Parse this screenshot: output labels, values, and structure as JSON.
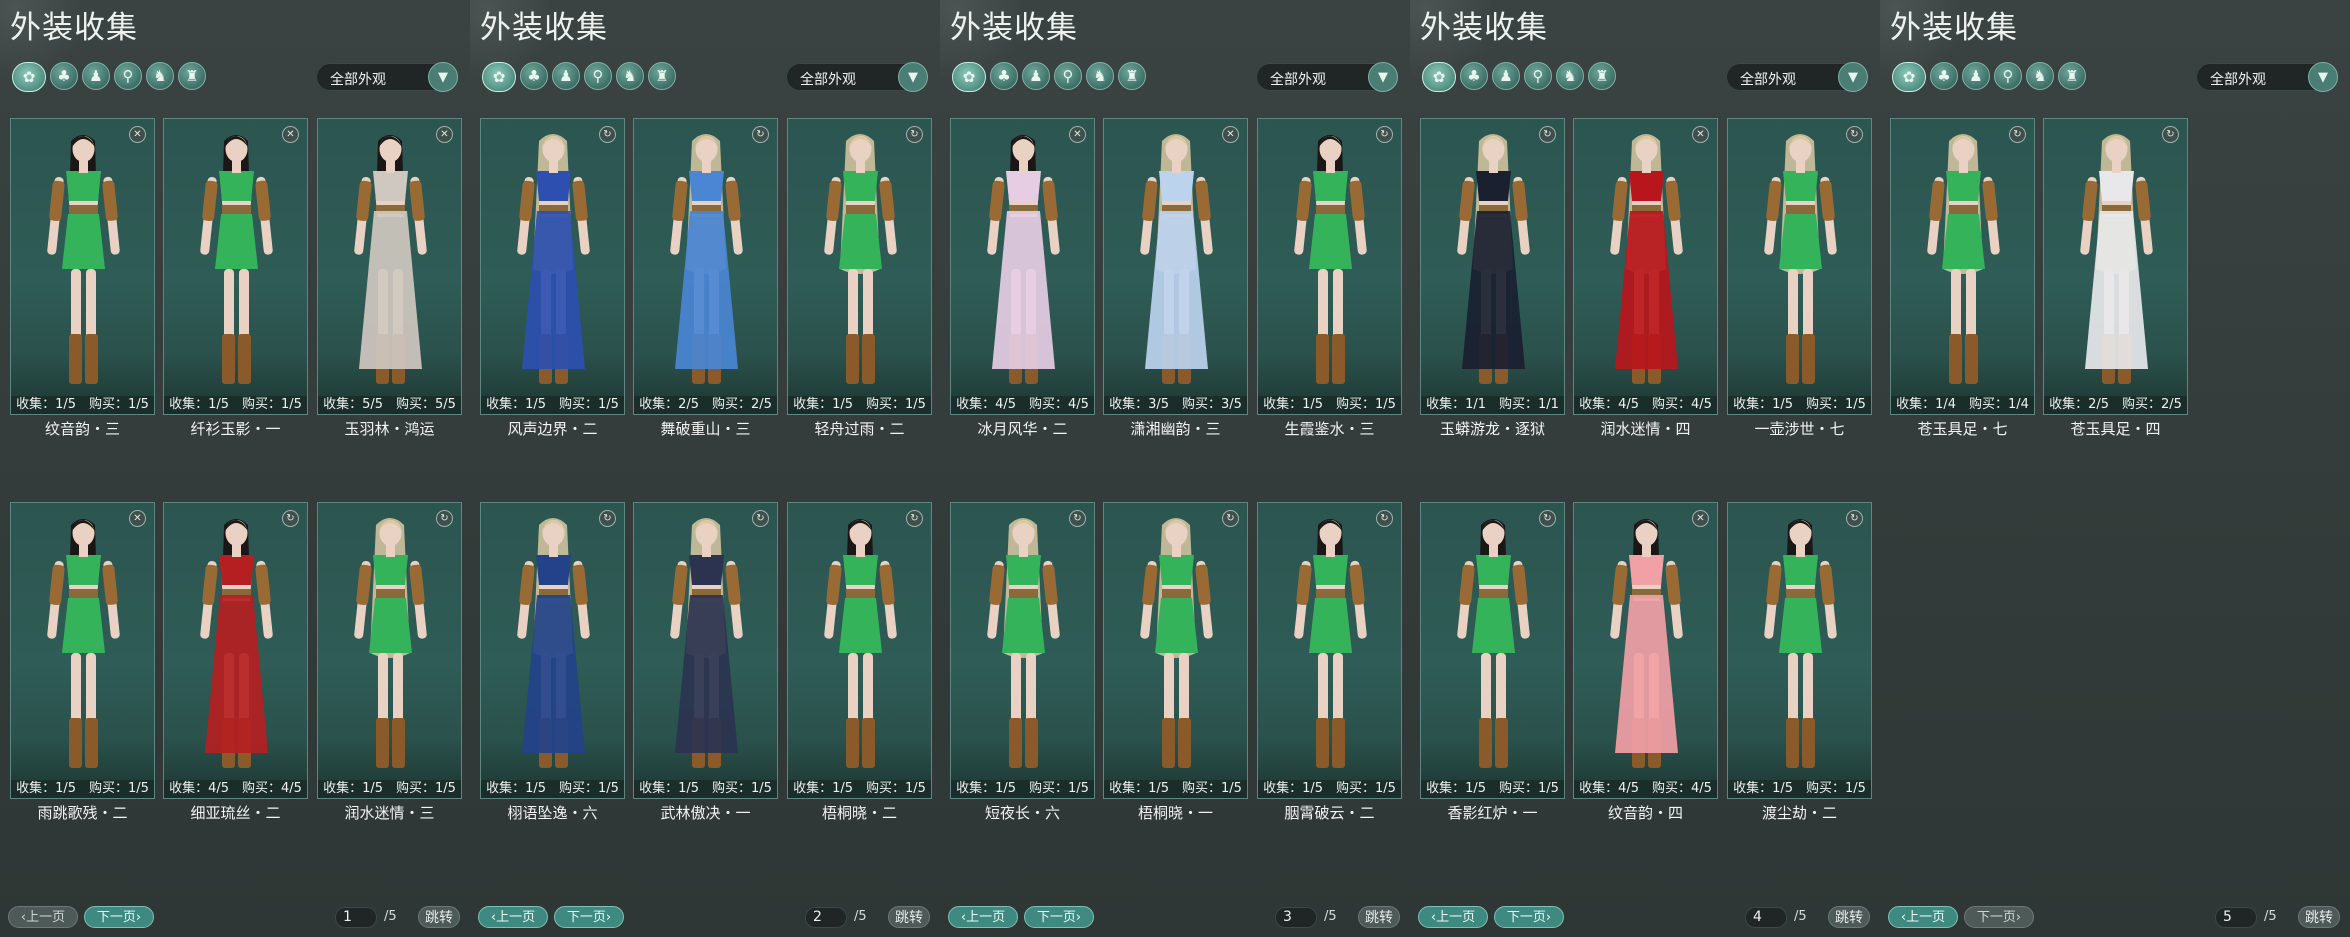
{
  "filter_label": "全部外观",
  "prev_label": "上一页",
  "next_label": "下一页",
  "jump_label": "跳转",
  "total_pages": "/5",
  "panels": [
    {
      "title": "外装收集",
      "page": "1",
      "items": [
        {
          "name": "纹音韵・三",
          "stats": "收集：1/5　购买：1/5",
          "icon": "trash-icon",
          "hair": "black",
          "outfit": "green"
        },
        {
          "name": "纤衫玉影・一",
          "stats": "收集：1/5　购买：1/5",
          "icon": "trash-icon",
          "hair": "black",
          "outfit": "green"
        },
        {
          "name": "玉羽林・鸿运",
          "stats": "收集：5/5　购买：5/5",
          "icon": "trash-icon",
          "hair": "black",
          "outfit": "#cfc8c0"
        },
        {
          "name": "雨跳歌残・二",
          "stats": "收集：1/5　购买：1/5",
          "icon": "trash-icon",
          "hair": "black",
          "outfit": "green"
        },
        {
          "name": "细亚琉丝・二",
          "stats": "收集：4/5　购买：4/5",
          "icon": "refresh-icon",
          "hair": "black",
          "outfit": "#b51f22"
        },
        {
          "name": "润水迷情・三",
          "stats": "收集：1/5　购买：1/5",
          "icon": "refresh-icon",
          "hair": "blonde",
          "outfit": "green"
        }
      ]
    },
    {
      "title": "外装收集",
      "page": "2",
      "items": [
        {
          "name": "风声边界・二",
          "stats": "收集：1/5　购买：1/5",
          "icon": "refresh-icon",
          "hair": "blonde",
          "outfit": "#2c4fb0"
        },
        {
          "name": "舞破重山・三",
          "stats": "收集：2/5　购买：2/5",
          "icon": "refresh-icon",
          "hair": "blonde",
          "outfit": "#4a86d4"
        },
        {
          "name": "轻舟过雨・二",
          "stats": "收集：1/5　购买：1/5",
          "icon": "refresh-icon",
          "hair": "blonde",
          "outfit": "green"
        },
        {
          "name": "栩语坠逸・六",
          "stats": "收集：1/5　购买：1/5",
          "icon": "refresh-icon",
          "hair": "blonde",
          "outfit": "#23428a"
        },
        {
          "name": "武林傲决・一",
          "stats": "收集：1/5　购买：1/5",
          "icon": "refresh-icon",
          "hair": "blonde",
          "outfit": "#2b3350"
        },
        {
          "name": "梧桐晓・二",
          "stats": "收集：1/5　购买：1/5",
          "icon": "refresh-icon",
          "hair": "black",
          "outfit": "green"
        }
      ]
    },
    {
      "title": "外装收集",
      "page": "3",
      "items": [
        {
          "name": "冰月风华・二",
          "stats": "收集：4/5　购买：4/5",
          "icon": "trash-icon",
          "hair": "black",
          "outfit": "#e6cde4"
        },
        {
          "name": "潇湘幽韵・三",
          "stats": "收集：3/5　购买：3/5",
          "icon": "trash-icon",
          "hair": "blonde",
          "outfit": "#bcd3ee"
        },
        {
          "name": "生霞鉴水・三",
          "stats": "收集：1/5　购买：1/5",
          "icon": "refresh-icon",
          "hair": "black",
          "outfit": "green"
        },
        {
          "name": "短夜长・六",
          "stats": "收集：1/5　购买：1/5",
          "icon": "refresh-icon",
          "hair": "blonde",
          "outfit": "green"
        },
        {
          "name": "梧桐晓・一",
          "stats": "收集：1/5　购买：1/5",
          "icon": "refresh-icon",
          "hair": "blonde",
          "outfit": "green"
        },
        {
          "name": "胭霄破云・二",
          "stats": "收集：1/5　购买：1/5",
          "icon": "refresh-icon",
          "hair": "black",
          "outfit": "green"
        }
      ]
    },
    {
      "title": "外装收集",
      "page": "4",
      "items": [
        {
          "name": "玉蟒游龙・逐狱",
          "stats": "收集：1/1　购买：1/1",
          "icon": "refresh-icon",
          "hair": "blonde",
          "outfit": "#1a2030"
        },
        {
          "name": "润水迷情・四",
          "stats": "收集：4/5　购买：4/5",
          "icon": "trash-icon",
          "hair": "blonde",
          "outfit": "#b8161c"
        },
        {
          "name": "一壶涉世・七",
          "stats": "收集：1/5　购买：1/5",
          "icon": "refresh-icon",
          "hair": "blonde",
          "outfit": "green"
        },
        {
          "name": "香影红炉・一",
          "stats": "收集：1/5　购买：1/5",
          "icon": "refresh-icon",
          "hair": "black",
          "outfit": "green"
        },
        {
          "name": "纹音韵・四",
          "stats": "收集：4/5　购买：4/5",
          "icon": "trash-icon",
          "hair": "black",
          "outfit": "#f1a0a6"
        },
        {
          "name": "渡尘劫・二",
          "stats": "收集：1/5　购买：1/5",
          "icon": "refresh-icon",
          "hair": "black",
          "outfit": "green"
        }
      ]
    },
    {
      "title": "外装收集",
      "page": "5",
      "items": [
        {
          "name": "苍玉具足・七",
          "stats": "收集：1/4　购买：1/4",
          "icon": "refresh-icon",
          "hair": "blonde",
          "outfit": "green"
        },
        {
          "name": "苍玉具足・四",
          "stats": "收集：2/5　购买：2/5",
          "icon": "refresh-icon",
          "hair": "blonde",
          "outfit": "#e8e8ea"
        }
      ]
    }
  ]
}
